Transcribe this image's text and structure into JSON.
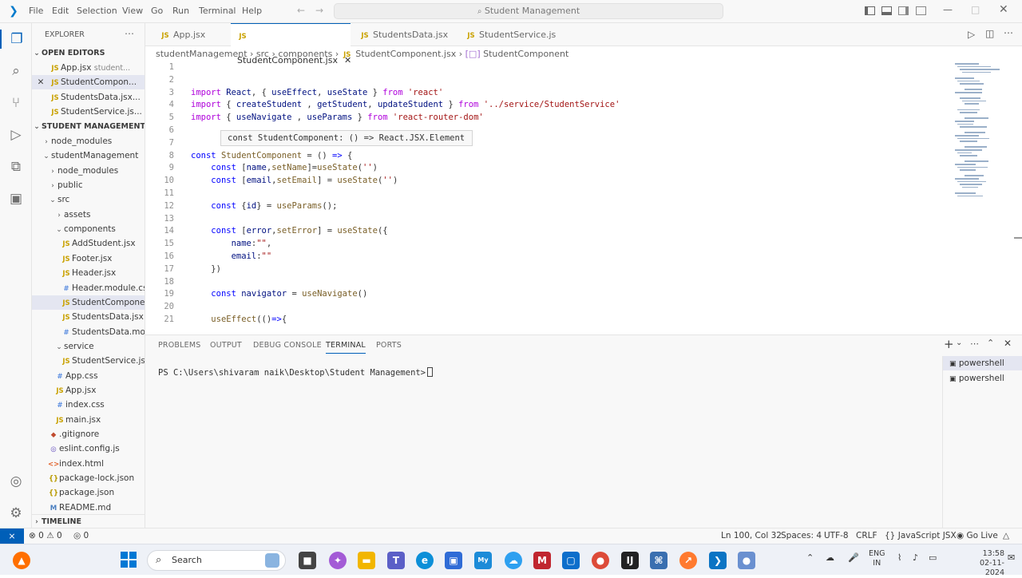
{
  "window": {
    "menus": [
      "File",
      "Edit",
      "Selection",
      "View",
      "Go",
      "Run",
      "Terminal",
      "Help"
    ],
    "command_center": "Student Management"
  },
  "sidebar": {
    "title": "EXPLORER",
    "open_editors": {
      "label": "OPEN EDITORS",
      "items": [
        {
          "name": "App.jsx",
          "hint": "student..."
        },
        {
          "name": "StudentCompon...",
          "hint": ""
        },
        {
          "name": "StudentsData.jsx...",
          "hint": ""
        },
        {
          "name": "StudentService.js...",
          "hint": ""
        }
      ]
    },
    "project": {
      "label": "STUDENT MANAGEMENT",
      "tree": [
        {
          "name": "node_modules",
          "kind": "folder",
          "depth": 1,
          "open": false
        },
        {
          "name": "studentManagement",
          "kind": "folder",
          "depth": 1,
          "open": true
        },
        {
          "name": "node_modules",
          "kind": "folder",
          "depth": 2,
          "open": false
        },
        {
          "name": "public",
          "kind": "folder",
          "depth": 2,
          "open": false
        },
        {
          "name": "src",
          "kind": "folder",
          "depth": 2,
          "open": true
        },
        {
          "name": "assets",
          "kind": "folder",
          "depth": 3,
          "open": false
        },
        {
          "name": "components",
          "kind": "folder",
          "depth": 3,
          "open": true
        },
        {
          "name": "AddStudent.jsx",
          "kind": "js",
          "depth": 4
        },
        {
          "name": "Footer.jsx",
          "kind": "js",
          "depth": 4
        },
        {
          "name": "Header.jsx",
          "kind": "js",
          "depth": 4
        },
        {
          "name": "Header.module.css",
          "kind": "css",
          "depth": 4
        },
        {
          "name": "StudentCompone...",
          "kind": "js",
          "depth": 4,
          "selected": true
        },
        {
          "name": "StudentsData.jsx",
          "kind": "js",
          "depth": 4
        },
        {
          "name": "StudentsData.mo...",
          "kind": "css",
          "depth": 4
        },
        {
          "name": "service",
          "kind": "folder",
          "depth": 3,
          "open": true
        },
        {
          "name": "StudentService.js",
          "kind": "js",
          "depth": 4
        },
        {
          "name": "App.css",
          "kind": "css",
          "depth": 3
        },
        {
          "name": "App.jsx",
          "kind": "js",
          "depth": 3
        },
        {
          "name": "index.css",
          "kind": "css",
          "depth": 3
        },
        {
          "name": "main.jsx",
          "kind": "js",
          "depth": 3
        },
        {
          "name": ".gitignore",
          "kind": "git",
          "depth": 2
        },
        {
          "name": "eslint.config.js",
          "kind": "cfg",
          "depth": 2
        },
        {
          "name": "index.html",
          "kind": "html",
          "depth": 2
        },
        {
          "name": "package-lock.json",
          "kind": "json",
          "depth": 2
        },
        {
          "name": "package.json",
          "kind": "json",
          "depth": 2
        },
        {
          "name": "README.md",
          "kind": "md",
          "depth": 2
        }
      ]
    },
    "timeline": "TIMELINE"
  },
  "tabs": [
    {
      "label": "App.jsx",
      "active": false
    },
    {
      "label": "StudentComponent.jsx",
      "active": true
    },
    {
      "label": "StudentsData.jsx",
      "active": false
    },
    {
      "label": "StudentService.js",
      "active": false
    }
  ],
  "breadcrumbs": [
    "studentManagement",
    "src",
    "components",
    "StudentComponent.jsx",
    "StudentComponent"
  ],
  "code_lines": [
    {
      "n": "1",
      "html": ""
    },
    {
      "n": "2",
      "html": ""
    },
    {
      "n": "3",
      "html": "<span class='kw2'>import</span> <span class='var'>React</span>, { <span class='var'>useEffect</span>, <span class='var'>useState</span> } <span class='kw2'>from</span> <span class='str'>'react'</span>"
    },
    {
      "n": "4",
      "html": "<span class='kw2'>import</span> { <span class='var'>createStudent</span> , <span class='var'>getStudent</span>, <span class='var'>updateStudent</span> } <span class='kw2'>from</span> <span class='str'>'../service/StudentService'</span>"
    },
    {
      "n": "5",
      "html": "<span class='kw2'>import</span> { <span class='var'>useNavigate</span> , <span class='var'>useParams</span> } <span class='kw2'>from</span> <span class='str'>'react-router-dom'</span>"
    },
    {
      "n": "6",
      "html": ""
    },
    {
      "n": "7",
      "html": ""
    },
    {
      "n": "8",
      "html": "<span class='kw'>const</span> <span class='fn'>StudentComponent</span> = () <span class='kw'>=&gt;</span> {"
    },
    {
      "n": "9",
      "html": "    <span class='kw'>const</span> [<span class='var'>name</span>,<span class='fn'>setName</span>]=<span class='fn'>useState</span>(<span class='str'>''</span>)"
    },
    {
      "n": "10",
      "html": "    <span class='kw'>const</span> [<span class='var'>email</span>,<span class='fn'>setEmail</span>] = <span class='fn'>useState</span>(<span class='str'>''</span>)"
    },
    {
      "n": "11",
      "html": ""
    },
    {
      "n": "12",
      "html": "    <span class='kw'>const</span> {<span class='var'>id</span>} = <span class='fn'>useParams</span>();"
    },
    {
      "n": "13",
      "html": ""
    },
    {
      "n": "14",
      "html": "    <span class='kw'>const</span> [<span class='var'>error</span>,<span class='fn'>setError</span>] = <span class='fn'>useState</span>({"
    },
    {
      "n": "15",
      "html": "        <span class='var'>name</span>:<span class='str'>\"\"</span>,"
    },
    {
      "n": "16",
      "html": "        <span class='var'>email</span>:<span class='str'>\"\"</span>"
    },
    {
      "n": "17",
      "html": "    })"
    },
    {
      "n": "18",
      "html": ""
    },
    {
      "n": "19",
      "html": "    <span class='kw'>const</span> <span class='var'>navigator</span> = <span class='fn'>useNavigate</span>()"
    },
    {
      "n": "20",
      "html": ""
    },
    {
      "n": "21",
      "html": "    <span class='fn'>useEffect</span>(()<span class='kw'>=&gt;</span>{"
    }
  ],
  "hover_tooltip": "const StudentComponent: () => React.JSX.Element",
  "panel": {
    "tabs": [
      "PROBLEMS",
      "OUTPUT",
      "DEBUG CONSOLE",
      "TERMINAL",
      "PORTS"
    ],
    "active_tab": "TERMINAL",
    "terminal_prompt": "PS C:\\Users\\shivaram naik\\Desktop\\Student Management>",
    "terminals": [
      "powershell",
      "powershell"
    ]
  },
  "status": {
    "errors": "0",
    "warnings": "0",
    "ports": "0",
    "cursor": "Ln 100, Col 32",
    "spaces": "Spaces: 4",
    "encoding": "UTF-8",
    "eol": "CRLF",
    "language": "JavaScript JSX",
    "golive": "Go Live"
  },
  "taskbar": {
    "search": "Search",
    "lang_top": "ENG",
    "lang_bottom": "IN",
    "time": "13:58",
    "date": "02-11-2024"
  },
  "colors": {
    "accent": "#005fb8"
  }
}
